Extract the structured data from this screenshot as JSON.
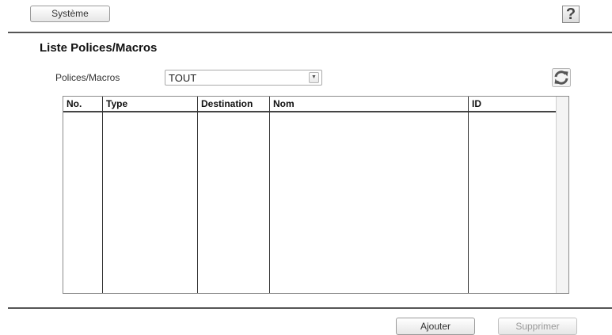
{
  "header": {
    "system_button": "Système",
    "help_button": "?"
  },
  "section": {
    "title": "Liste Polices/Macros"
  },
  "filter": {
    "label": "Polices/Macros",
    "selected": "TOUT"
  },
  "table": {
    "columns": [
      "No.",
      "Type",
      "Destination",
      "Nom",
      "ID"
    ],
    "rows": []
  },
  "actions": {
    "add_label": "Ajouter",
    "delete_label": "Supprimer",
    "delete_enabled": false
  },
  "icons": {
    "refresh": "refresh-icon",
    "dropdown": "chevron-down-icon",
    "help": "help-icon"
  }
}
